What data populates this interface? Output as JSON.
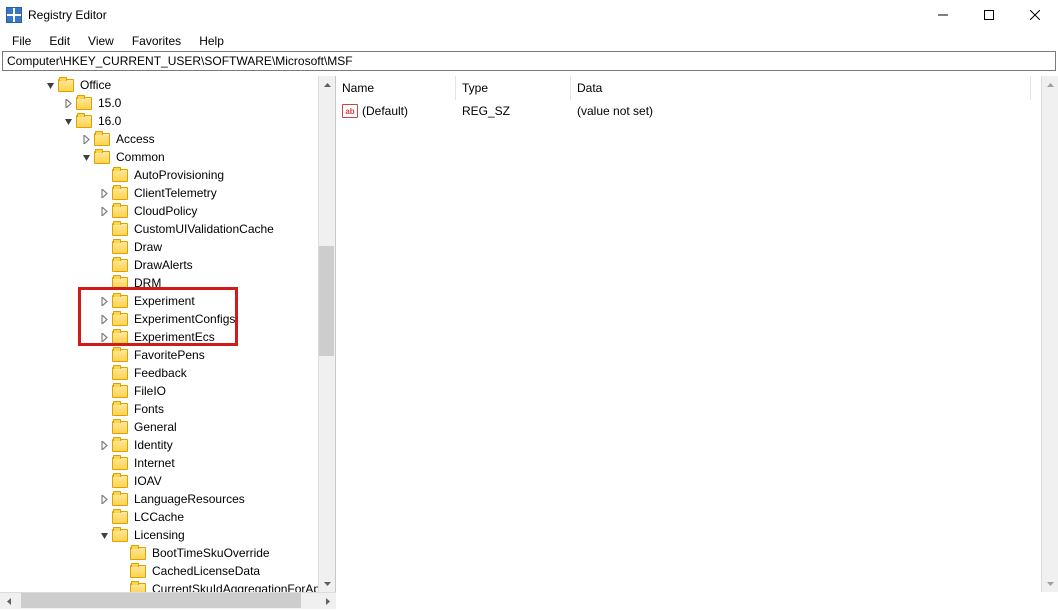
{
  "window": {
    "title": "Registry Editor"
  },
  "menu": {
    "file": "File",
    "edit": "Edit",
    "view": "View",
    "favorites": "Favorites",
    "help": "Help"
  },
  "address": {
    "path": "Computer\\HKEY_CURRENT_USER\\SOFTWARE\\Microsoft\\MSF"
  },
  "tree": {
    "nodes": [
      {
        "indent": 45,
        "exp": "expanded",
        "label": "Office"
      },
      {
        "indent": 63,
        "exp": "collapsed",
        "label": "15.0"
      },
      {
        "indent": 63,
        "exp": "expanded",
        "label": "16.0"
      },
      {
        "indent": 81,
        "exp": "collapsed",
        "label": "Access"
      },
      {
        "indent": 81,
        "exp": "expanded",
        "label": "Common"
      },
      {
        "indent": 99,
        "exp": "none",
        "label": "AutoProvisioning"
      },
      {
        "indent": 99,
        "exp": "collapsed",
        "label": "ClientTelemetry"
      },
      {
        "indent": 99,
        "exp": "collapsed",
        "label": "CloudPolicy"
      },
      {
        "indent": 99,
        "exp": "none",
        "label": "CustomUIValidationCache"
      },
      {
        "indent": 99,
        "exp": "none",
        "label": "Draw"
      },
      {
        "indent": 99,
        "exp": "none",
        "label": "DrawAlerts"
      },
      {
        "indent": 99,
        "exp": "none",
        "label": "DRM"
      },
      {
        "indent": 99,
        "exp": "collapsed",
        "label": "Experiment"
      },
      {
        "indent": 99,
        "exp": "collapsed",
        "label": "ExperimentConfigs"
      },
      {
        "indent": 99,
        "exp": "collapsed",
        "label": "ExperimentEcs"
      },
      {
        "indent": 99,
        "exp": "none",
        "label": "FavoritePens"
      },
      {
        "indent": 99,
        "exp": "none",
        "label": "Feedback"
      },
      {
        "indent": 99,
        "exp": "none",
        "label": "FileIO"
      },
      {
        "indent": 99,
        "exp": "none",
        "label": "Fonts"
      },
      {
        "indent": 99,
        "exp": "none",
        "label": "General"
      },
      {
        "indent": 99,
        "exp": "collapsed",
        "label": "Identity"
      },
      {
        "indent": 99,
        "exp": "none",
        "label": "Internet"
      },
      {
        "indent": 99,
        "exp": "none",
        "label": "IOAV"
      },
      {
        "indent": 99,
        "exp": "collapsed",
        "label": "LanguageResources"
      },
      {
        "indent": 99,
        "exp": "none",
        "label": "LCCache"
      },
      {
        "indent": 99,
        "exp": "expanded",
        "label": "Licensing"
      },
      {
        "indent": 117,
        "exp": "none",
        "label": "BootTimeSkuOverride"
      },
      {
        "indent": 117,
        "exp": "none",
        "label": "CachedLicenseData"
      },
      {
        "indent": 117,
        "exp": "none",
        "label": "CurrentSkuIdAggregationForApp"
      }
    ]
  },
  "list": {
    "columns": {
      "name": "Name",
      "type": "Type",
      "data": "Data"
    },
    "widths": {
      "name": 120,
      "type": 115,
      "data": 460
    },
    "rows": [
      {
        "icon": "string",
        "name": "(Default)",
        "type": "REG_SZ",
        "data": "(value not set)"
      }
    ]
  }
}
